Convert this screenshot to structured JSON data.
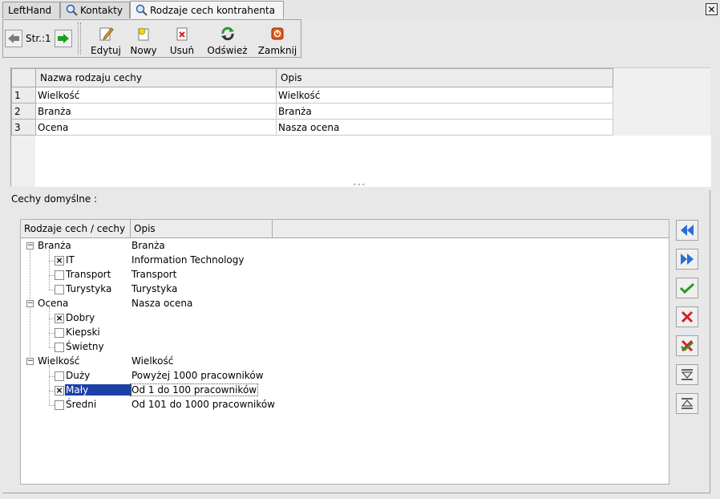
{
  "tabs": [
    {
      "label": "LeftHand",
      "icon": "none"
    },
    {
      "label": "Kontakty",
      "icon": "search-people-icon"
    },
    {
      "label": "Rodzaje cech kontrahenta",
      "icon": "search-people-icon",
      "active": true
    }
  ],
  "toolbar": {
    "page_label": "Str.:1",
    "buttons": [
      {
        "label": "Edytuj",
        "icon": "edit-icon"
      },
      {
        "label": "Nowy",
        "icon": "new-icon"
      },
      {
        "label": "Usuń",
        "icon": "delete-icon"
      },
      {
        "label": "Odśwież",
        "icon": "refresh-icon"
      },
      {
        "label": "Zamknij",
        "icon": "close-icon"
      }
    ]
  },
  "grid": {
    "columns": [
      "Nazwa rodzaju cechy",
      "Opis"
    ],
    "rows": [
      {
        "n": "1",
        "name": "Wielkość",
        "opis": "Wielkość"
      },
      {
        "n": "2",
        "name": "Branża",
        "opis": "Branża"
      },
      {
        "n": "3",
        "name": "Ocena",
        "opis": "Nasza ocena"
      }
    ]
  },
  "panel": {
    "title": "Cechy domyślne :",
    "tree_columns": [
      "Rodzaje cech / cechy",
      "Opis"
    ],
    "groups": [
      {
        "label": "Branża",
        "opis": "Branża",
        "items": [
          {
            "label": "IT",
            "opis": "Information Technology",
            "checked": true
          },
          {
            "label": "Transport",
            "opis": "Transport",
            "checked": false
          },
          {
            "label": "Turystyka",
            "opis": "Turystyka",
            "checked": false
          }
        ]
      },
      {
        "label": "Ocena",
        "opis": "Nasza ocena",
        "items": [
          {
            "label": "Dobry",
            "opis": "",
            "checked": true
          },
          {
            "label": "Kiepski",
            "opis": "",
            "checked": false
          },
          {
            "label": "Świetny",
            "opis": "",
            "checked": false
          }
        ]
      },
      {
        "label": "Wielkość",
        "opis": "Wielkość",
        "items": [
          {
            "label": "Duży",
            "opis": "Powyżej 1000 pracowników",
            "checked": false
          },
          {
            "label": "Mały",
            "opis": "Od 1 do 100 pracowników",
            "checked": true,
            "selected": true
          },
          {
            "label": "Średni",
            "opis": "Od 101 do 1000 pracowników",
            "checked": false
          }
        ]
      }
    ],
    "side_buttons": [
      "first-icon",
      "last-icon",
      "check-icon",
      "cross-icon",
      "check-cross-icon",
      "move-down-icon",
      "move-up-icon"
    ]
  },
  "colors": {
    "selection": "#1c3fa8",
    "accent_blue": "#2a6fd6",
    "green": "#2a9a2a",
    "red": "#d62020"
  }
}
